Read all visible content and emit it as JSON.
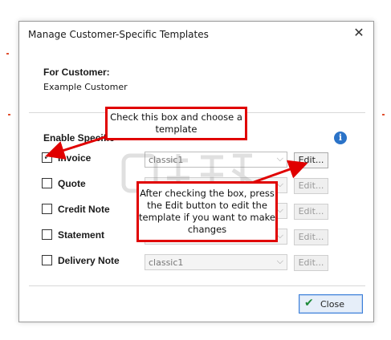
{
  "dialog": {
    "title": "Manage Customer-Specific Templates",
    "close_glyph": "✕"
  },
  "customer": {
    "label": "For Customer:",
    "name": "Example Customer"
  },
  "enable": {
    "label": "Enable Specific"
  },
  "info_icon": "i",
  "rows": [
    {
      "label": "Invoice",
      "checked": true,
      "template": "classic1",
      "edit": "Edit..."
    },
    {
      "label": "Quote",
      "checked": false,
      "template": "",
      "edit": "Edit..."
    },
    {
      "label": "Credit Note",
      "checked": false,
      "template": "",
      "edit": "Edit..."
    },
    {
      "label": "Statement",
      "checked": false,
      "template": "",
      "edit": "Edit..."
    },
    {
      "label": "Delivery Note",
      "checked": false,
      "template": "classic1",
      "edit": "Edit..."
    }
  ],
  "close_button": {
    "label": "Close",
    "icon": "check-icon"
  },
  "callouts": {
    "top": "Check this box and choose a template",
    "bottom": "After checking the box, press the Edit button to edit the template if you want to make changes"
  },
  "colors": {
    "callout_border": "#e00000",
    "info_blue": "#2b73c8",
    "close_border": "#3c7fd9"
  }
}
